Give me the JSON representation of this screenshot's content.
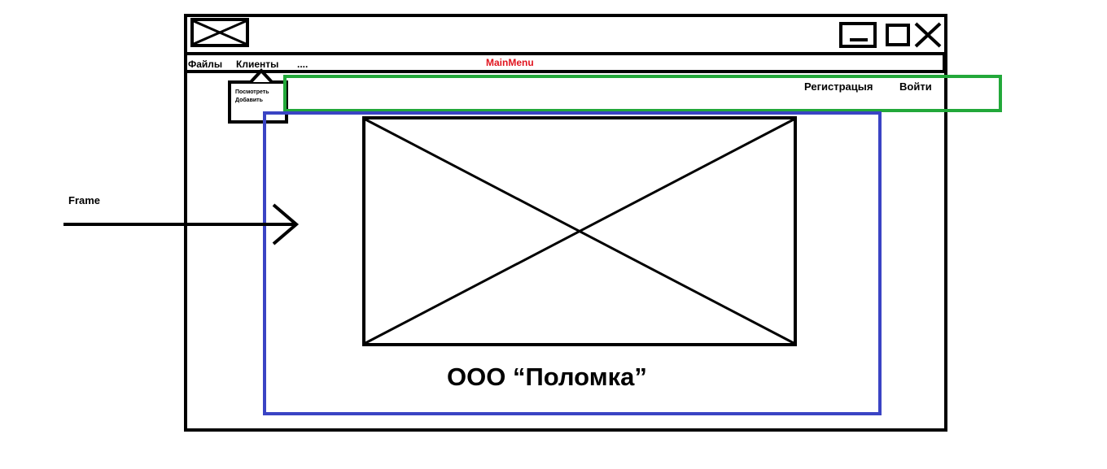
{
  "menubar": {
    "items": [
      "Файлы",
      "Клиенты",
      "...."
    ],
    "annotation": "MainMenu",
    "annotation_color": "#e0141e"
  },
  "dropdown": {
    "items": [
      "Посмотреть",
      "Добавить"
    ]
  },
  "auth_bar": {
    "register_label": "Регистрацыя",
    "login_label": "Войти",
    "frame_color": "#22a83a"
  },
  "content_frame": {
    "company_name": "ООО “Поломка”",
    "frame_color": "#3a44c4"
  },
  "external": {
    "frame_label": "Frame"
  },
  "icons": [
    "logo-placeholder-icon",
    "minimize-icon",
    "maximize-icon",
    "close-icon",
    "image-placeholder-icon",
    "arrow-icon",
    "dropdown-caret-icon"
  ]
}
